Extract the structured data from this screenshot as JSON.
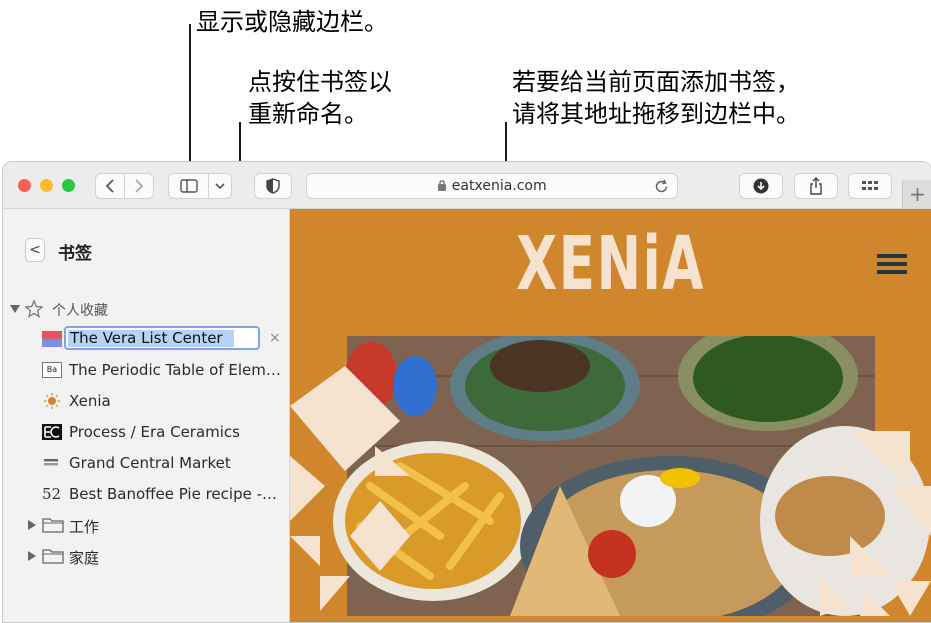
{
  "callouts": {
    "sidebar_toggle": "显示或隐藏边栏。",
    "rename_line1": "点按住书签以",
    "rename_line2": "重新命名。",
    "addbookmark_line1": "若要给当前页面添加书签，",
    "addbookmark_line2": "请将其地址拖移到边栏中。"
  },
  "toolbar": {
    "url": "eatxenia.com",
    "traffic_colors": [
      "#fe5f57",
      "#febc2e",
      "#28c840"
    ],
    "icons": [
      "chevron-left-icon",
      "chevron-right-icon",
      "sidebar-icon",
      "chevron-down-icon",
      "shield-icon",
      "lock-icon",
      "reload-icon",
      "download-icon",
      "share-icon",
      "grid-icon",
      "plus-icon"
    ],
    "new_tab": "+"
  },
  "sidebar": {
    "back": "<",
    "title": "书签",
    "favorites_label": "个人收藏",
    "items": [
      {
        "label": "The Vera List Center",
        "editing": true
      },
      {
        "label": "The Periodic Table of Elem…"
      },
      {
        "label": "Xenia"
      },
      {
        "label": "Process / Era Ceramics"
      },
      {
        "label": "Grand Central Market"
      },
      {
        "label": "Best Banoffee Pie recipe -…"
      }
    ],
    "folders": [
      {
        "label": "工作"
      },
      {
        "label": "家庭"
      }
    ],
    "clear": "×",
    "ba_icon_text": "Ba",
    "num_icon_text": "52"
  },
  "webpage": {
    "logo": "XENiA",
    "background": "#d0862d",
    "logo_color": "#f5e3cf"
  }
}
